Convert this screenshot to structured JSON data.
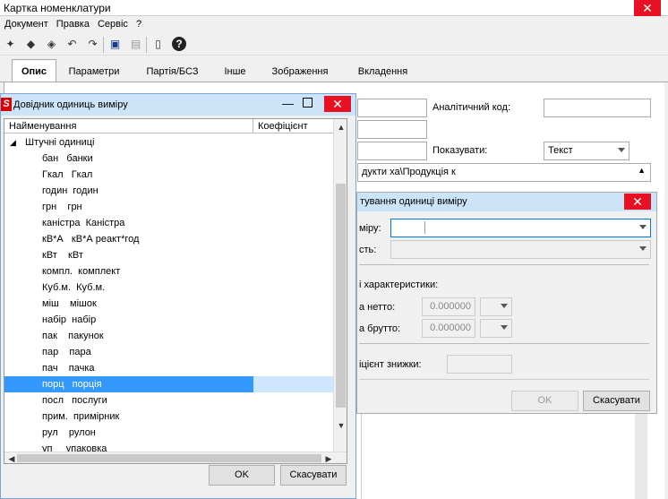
{
  "window": {
    "title": "Картка номенклатури",
    "close": "✕"
  },
  "menu": [
    "Документ",
    "Правка",
    "Сервіс",
    "?"
  ],
  "tabs": [
    "Опис",
    "Параметри",
    "Партія/БСЗ",
    "Інше",
    "Зображення",
    "Вкладення"
  ],
  "form": {
    "analytic_code_label": "Аналітичний код:",
    "show_label": "Показувати:",
    "show_value": "Текст",
    "group_path": "дукти ха\\Продукція к"
  },
  "dialog_edit": {
    "title": "тування одиниці виміру",
    "unit_label": "міру:",
    "ratio_label": "сть:",
    "chars_label": "і характеристики:",
    "net_label": "а нетто:",
    "net_value": "0.000000",
    "gross_label": "а брутто:",
    "gross_value": "0.000000",
    "discount_label": "іцієнт знижки:",
    "ok": "OK",
    "cancel": "Скасувати"
  },
  "dialog_units": {
    "title": "Довідник одиниць виміру",
    "col_name": "Найменування",
    "col_coef": "Коефіцієнт",
    "group": "Штучні одиниці",
    "items": [
      "бан   банки",
      "Гкал   Гкал",
      "годин  годин",
      "грн    грн",
      "каністра  Каністра",
      "кВ*А   кВ*А реакт*год",
      "кВт    кВт",
      "компл.  комплект",
      "Куб.м.  Куб.м.",
      "міш    мішок",
      "набір  набір",
      "пак    пакунок",
      "пар    пара",
      "пач    пачка",
      "порц   порція",
      "посл   послуги",
      "прим.  примірник",
      "рул    рулон",
      "уп     упаковка"
    ],
    "selected_index": 14,
    "ok": "OK",
    "cancel": "Скасувати"
  }
}
